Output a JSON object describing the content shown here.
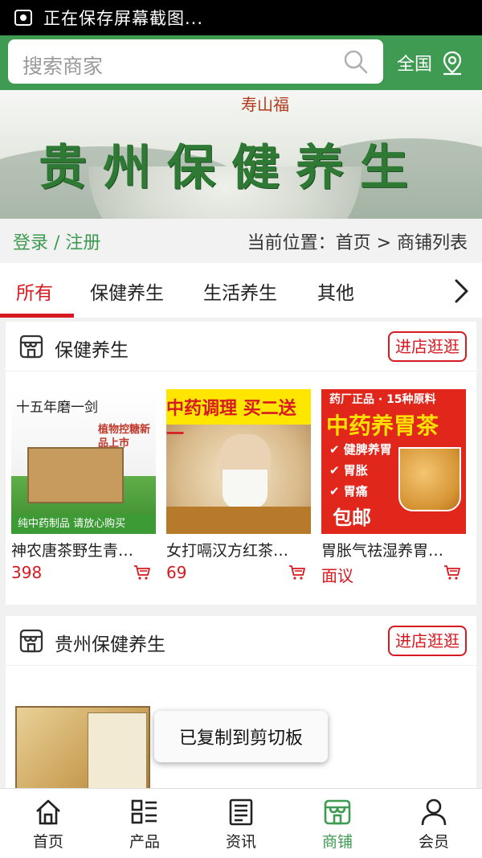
{
  "status_bar": {
    "text": "正在保存屏幕截图..."
  },
  "search": {
    "placeholder": "搜索商家",
    "region": "全国"
  },
  "banner": {
    "title": "贵州保健养生",
    "seal_text": "寿山福"
  },
  "crumbs": {
    "login": "登录 / 注册",
    "position": "当前位置：首页 > 商铺列表"
  },
  "tabs": [
    {
      "label": "所有",
      "active": true
    },
    {
      "label": "保健养生",
      "active": false
    },
    {
      "label": "生活养生",
      "active": false
    },
    {
      "label": "其他",
      "active": false
    }
  ],
  "shops": [
    {
      "name": "保健养生",
      "visit_label": "进店逛逛",
      "products": [
        {
          "name": "神农唐茶野生青…",
          "price": "398",
          "img_title": "十五年磨一剑",
          "img_slogan": "植物控糖新品上市",
          "img_bar": "纯中药制品   请放心购买"
        },
        {
          "name": "女打嗝汉方红茶…",
          "price": "69",
          "img_title": "中药调理 买二送一"
        },
        {
          "name": "胃胀气祛湿养胃…",
          "price": "面议",
          "img_top": "药厂正品 · 15种原料",
          "img_big": "中药养胃茶",
          "img_items": [
            "✔ 健脾养胃",
            "✔ 胃胀",
            "✔ 胃痛"
          ],
          "img_post": "包邮"
        }
      ]
    },
    {
      "name": "贵州保健养生",
      "visit_label": "进店逛逛"
    }
  ],
  "toast": "已复制到剪切板",
  "bottom_nav": [
    {
      "label": "首页",
      "icon": "home-icon",
      "active": false
    },
    {
      "label": "产品",
      "icon": "products-icon",
      "active": false
    },
    {
      "label": "资讯",
      "icon": "news-icon",
      "active": false
    },
    {
      "label": "商铺",
      "icon": "store-icon",
      "active": true
    },
    {
      "label": "会员",
      "icon": "member-icon",
      "active": false
    }
  ],
  "colors": {
    "brand_green": "#3f9a52",
    "accent_red": "#d71920"
  }
}
